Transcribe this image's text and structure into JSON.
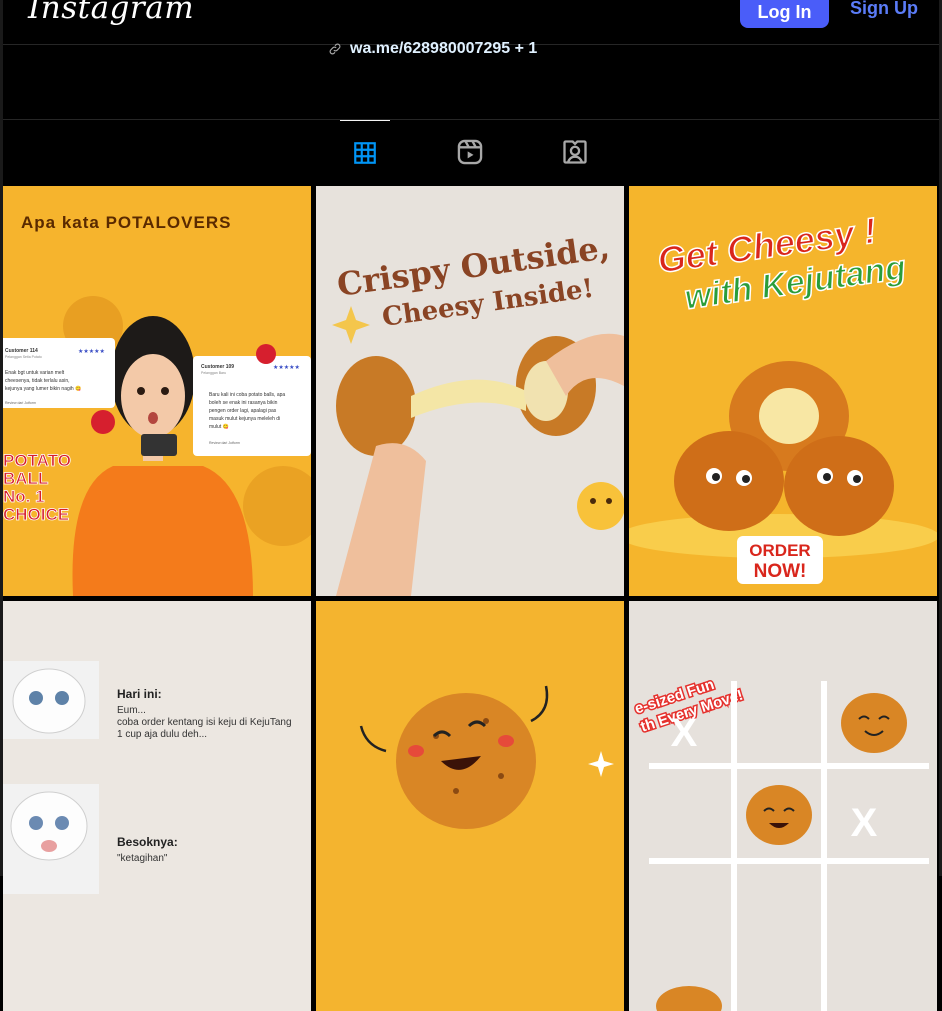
{
  "header": {
    "logo": "Instagram",
    "login_label": "Log In",
    "signup_label": "Sign Up"
  },
  "bio": {
    "link_text": "wa.me/628980007295 + 1"
  },
  "tabs": [
    {
      "name": "posts",
      "icon": "grid-icon",
      "active": true
    },
    {
      "name": "reels",
      "icon": "reels-icon",
      "active": false
    },
    {
      "name": "tagged",
      "icon": "tagged-icon",
      "active": false
    }
  ],
  "colors": {
    "accent": "#4a5df9",
    "link": "#e0f1ff",
    "tab_active": "#0095f6",
    "tab_inactive": "#a8a8a8"
  },
  "posts": {
    "p1": {
      "title": "Apa kata POTALOVERS",
      "review1_name": "Customer 114",
      "review1_sub": "Pelanggan Setia Potato",
      "review1_stars": "★★★★★",
      "review1_text": [
        "Enak bgt untuk varian melt",
        "cheesenya, tidak terlalu asin,",
        "kejunya yang lumer bikin nagih 😋"
      ],
      "review1_source": "Review dari Jotform",
      "review2_name": "Customer 109",
      "review2_sub": "Pelanggan Baru",
      "review2_stars": "★★★★★",
      "review2_text": [
        "Baru kali ini coba potato balls, apa",
        "boleh se enak ini rasanya bikin",
        "pengen order lagi, apalagi pas",
        "masuk mulut kejunya meleleh di",
        "mulut 😋"
      ],
      "review2_source": "Review dari Jotform",
      "badge": [
        "POTATO",
        "BALL",
        "No. 1",
        "CHOICE"
      ]
    },
    "p2": {
      "line1": "Crispy Outside,",
      "line2": "Cheesy Inside!"
    },
    "p3": {
      "line1": "Get Cheesy !",
      "line2": "with Kejutang",
      "cta1": "ORDER",
      "cta2": "NOW!"
    },
    "p4": {
      "today_label": "Hari ini:",
      "today_text": [
        "Eum...",
        "coba order kentang isi keju di KejuTang",
        "1 cup aja dulu deh..."
      ],
      "tomorrow_label": "Besoknya:",
      "tomorrow_text": "\"ketagihan\""
    },
    "p6": {
      "banner1": "e-sized Fun",
      "banner2": "th Every Move!",
      "x1": "X",
      "x2": "X"
    }
  }
}
